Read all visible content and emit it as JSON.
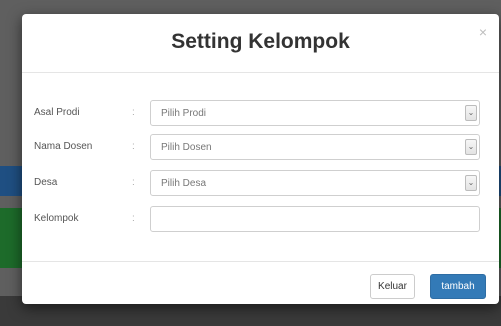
{
  "modal": {
    "title": "Setting Kelompok",
    "close_glyph": "×"
  },
  "form": {
    "rows": [
      {
        "label": "Asal Prodi",
        "separator": ":",
        "type": "select",
        "value": "Pilih Prodi"
      },
      {
        "label": "Nama Dosen",
        "separator": ":",
        "type": "select",
        "value": "Pilih Dosen"
      },
      {
        "label": "Desa",
        "separator": ":",
        "type": "select",
        "value": "Pilih Desa"
      },
      {
        "label": "Kelompok",
        "separator": ":",
        "type": "text",
        "value": ""
      }
    ]
  },
  "footer": {
    "cancel_label": "Keluar",
    "submit_label": "tambah"
  },
  "colors": {
    "primary": "#337ab7",
    "backdrop": "#5f5f5f"
  },
  "icons": {
    "close": "close-icon",
    "select_arrow": "chevron-down-icon"
  }
}
